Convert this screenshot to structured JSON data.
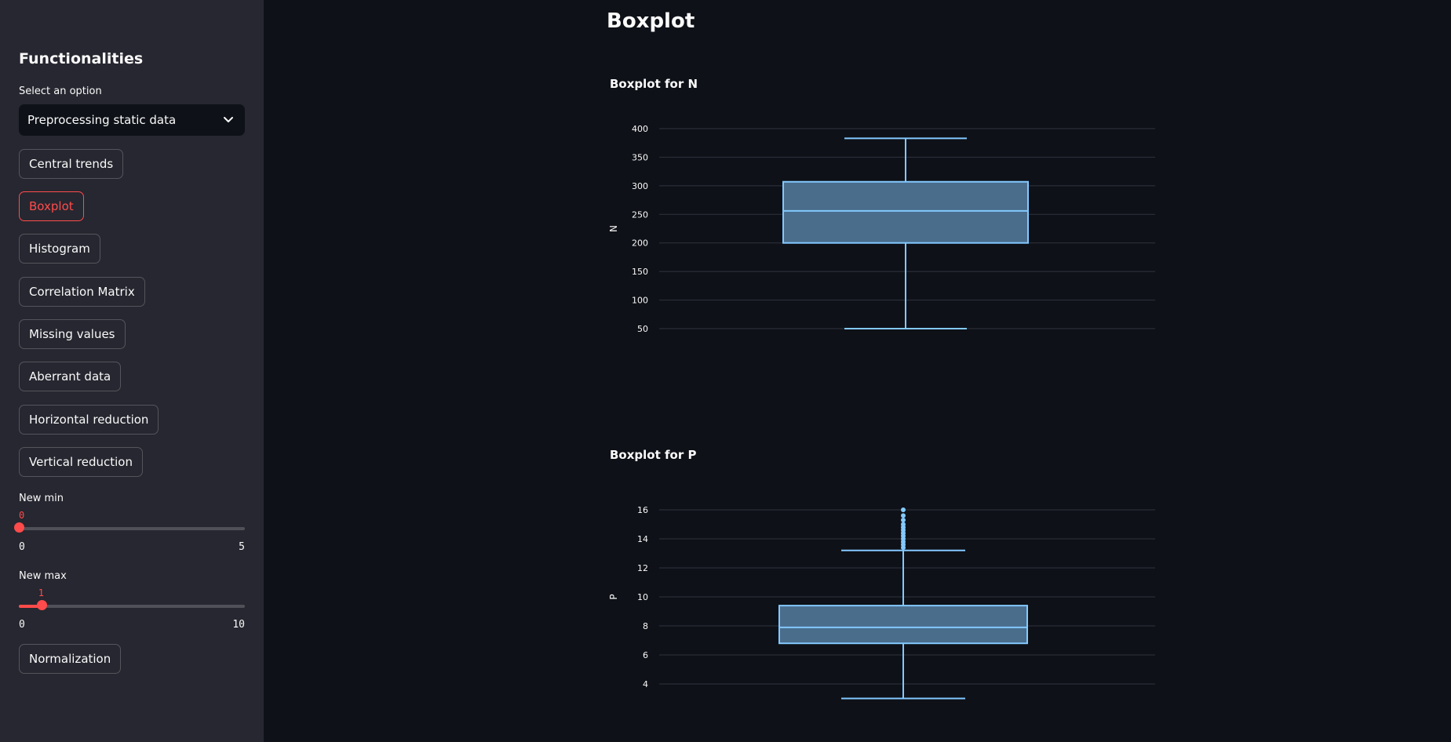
{
  "sidebar": {
    "title": "Functionalities",
    "select_label": "Select an option",
    "select_value": "Preprocessing static data",
    "buttons": [
      {
        "label": "Central trends",
        "active": false
      },
      {
        "label": "Boxplot",
        "active": true
      },
      {
        "label": "Histogram",
        "active": false
      },
      {
        "label": "Correlation Matrix",
        "active": false
      },
      {
        "label": "Missing values",
        "active": false
      },
      {
        "label": "Aberrant data",
        "active": false
      },
      {
        "label": "Horizontal reduction",
        "active": false
      },
      {
        "label": "Vertical reduction",
        "active": false
      }
    ],
    "slider_min": {
      "label": "New min",
      "value": "0",
      "min": "0",
      "max": "5",
      "fraction": 0
    },
    "slider_max": {
      "label": "New max",
      "value": "1",
      "min": "0",
      "max": "10",
      "fraction": 0.1
    },
    "normalization_label": "Normalization"
  },
  "main": {
    "title": "Boxplot"
  },
  "colors": {
    "accent": "#ff4b4b",
    "box_fill": "#4a6d8c",
    "box_stroke": "#83c9ff",
    "grid": "#31333f"
  },
  "chart_data": [
    {
      "type": "box",
      "title": "Boxplot for N",
      "ylabel": "N",
      "yticks": [
        50,
        100,
        150,
        200,
        250,
        300,
        350,
        400
      ],
      "ylim": [
        50,
        400
      ],
      "whisker_low": 50,
      "q1": 200,
      "median": 256,
      "q3": 307,
      "whisker_high": 383,
      "outliers": []
    },
    {
      "type": "box",
      "title": "Boxplot for P",
      "ylabel": "P",
      "yticks": [
        4,
        6,
        8,
        10,
        12,
        14,
        16
      ],
      "ylim": [
        4,
        16
      ],
      "whisker_low": 3.0,
      "q1": 6.8,
      "median": 7.9,
      "q3": 9.4,
      "whisker_high": 13.2,
      "outliers": [
        13.4,
        13.6,
        13.8,
        14.0,
        14.2,
        14.4,
        14.6,
        14.8,
        15.0,
        15.3,
        15.6,
        16.0
      ]
    }
  ]
}
